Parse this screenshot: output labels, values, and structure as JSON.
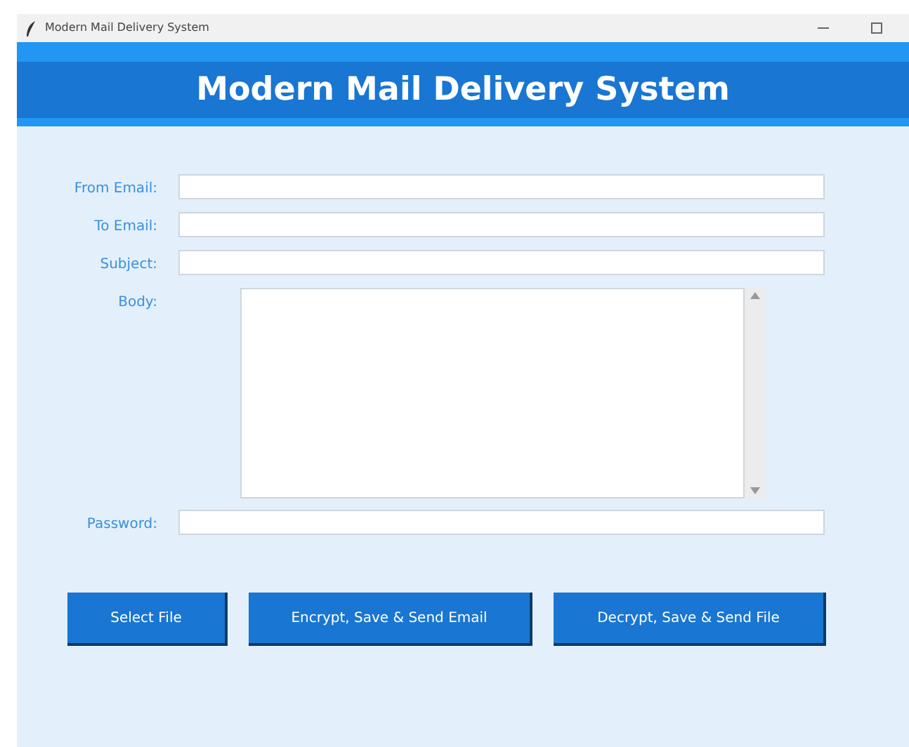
{
  "window": {
    "title": "Modern Mail Delivery System"
  },
  "header": {
    "title": "Modern Mail Delivery System"
  },
  "fields": [
    {
      "label": "From Email:",
      "kind": "line"
    },
    {
      "label": "To Email:",
      "kind": "line"
    },
    {
      "label": "Subject:",
      "kind": "line"
    },
    {
      "label": "Body:",
      "kind": "area"
    },
    {
      "label": "Password:",
      "kind": "line"
    }
  ],
  "buttons": [
    "Select File",
    "Encrypt, Save & Send Email",
    "Decrypt, Save & Send File"
  ]
}
